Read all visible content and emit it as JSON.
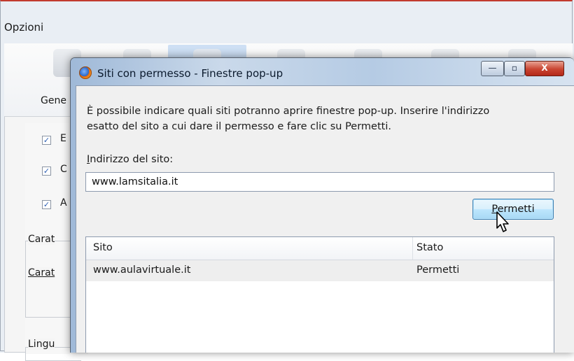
{
  "parent_window": {
    "title": "Opzioni",
    "toolbar_label": "Gene",
    "checkbox_labels": [
      "E",
      "C",
      "A"
    ],
    "group_labels": [
      "Carat",
      "Carat",
      "Lingu"
    ]
  },
  "dialog": {
    "title": "Siti con permesso - Finestre pop-up",
    "caption": {
      "minimize": "—",
      "maximize": "▫",
      "close": "X"
    },
    "instructions": "È possibile indicare quali siti potranno aprire finestre pop-up. Inserire l'indirizzo esatto del sito a cui dare il permesso e fare clic su Permetti.",
    "address_label_accel": "I",
    "address_label_rest": "ndirizzo del sito:",
    "address_value": "www.lamsitalia.it",
    "allow_button_accel": "P",
    "allow_button_rest": "ermetti",
    "table": {
      "columns": [
        "Sito",
        "Stato"
      ],
      "rows": [
        {
          "site": "www.aulavirtuale.it",
          "status": "Permetti"
        }
      ]
    }
  },
  "colors": {
    "title_accent": "#c23a2e",
    "selection_row": "#eeeeee",
    "button_border": "#3c7fb1"
  }
}
